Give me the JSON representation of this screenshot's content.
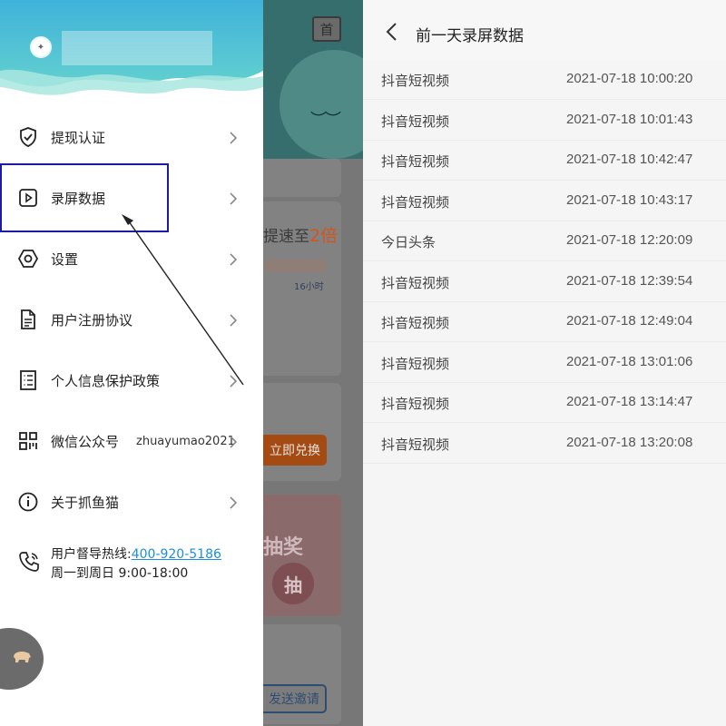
{
  "drawer": {
    "menu": [
      {
        "label": "提现认证",
        "icon": "shield-check-icon"
      },
      {
        "label": "录屏数据",
        "icon": "play-square-icon"
      },
      {
        "label": "设置",
        "icon": "hexagon-settings-icon"
      },
      {
        "label": "用户注册协议",
        "icon": "document-icon"
      },
      {
        "label": "个人信息保护政策",
        "icon": "list-document-icon"
      },
      {
        "label": "微信公众号",
        "value": "zhuayumao2021",
        "icon": "qr-code-icon"
      },
      {
        "label": "关于抓鱼猫",
        "icon": "info-circle-icon"
      }
    ],
    "hotline": {
      "prefix": "用户督导热线:",
      "phone": "400-920-5186",
      "hours": "周一到周日 9:00-18:00",
      "icon": "phone-icon"
    }
  },
  "background_app": {
    "home_badge": "首",
    "speed_prefix": "提速至",
    "speed_value": "2倍",
    "hours": "16小时",
    "redeem_button": "立即兑换",
    "lottery_text": "抽奖",
    "lottery_circle": "抽",
    "invite_button": "发送邀请"
  },
  "records_page": {
    "title": "前一天录屏数据",
    "items": [
      {
        "app": "抖音短视频",
        "time": "2021-07-18 10:00:20"
      },
      {
        "app": "抖音短视频",
        "time": "2021-07-18 10:01:43"
      },
      {
        "app": "抖音短视频",
        "time": "2021-07-18 10:42:47"
      },
      {
        "app": "抖音短视频",
        "time": "2021-07-18 10:43:17"
      },
      {
        "app": "今日头条",
        "time": "2021-07-18 12:20:09"
      },
      {
        "app": "抖音短视频",
        "time": "2021-07-18 12:39:54"
      },
      {
        "app": "抖音短视频",
        "time": "2021-07-18 12:49:04"
      },
      {
        "app": "抖音短视频",
        "time": "2021-07-18 13:01:06"
      },
      {
        "app": "抖音短视频",
        "time": "2021-07-18 13:14:47"
      },
      {
        "app": "抖音短视频",
        "time": "2021-07-18 13:20:08"
      }
    ]
  },
  "colors": {
    "header_top": "#3fb8d8",
    "header_wave": "#7ad6d0",
    "link": "#1a8fe0",
    "highlight_box": "#1b1ba8",
    "accent_orange": "#d2551c"
  }
}
